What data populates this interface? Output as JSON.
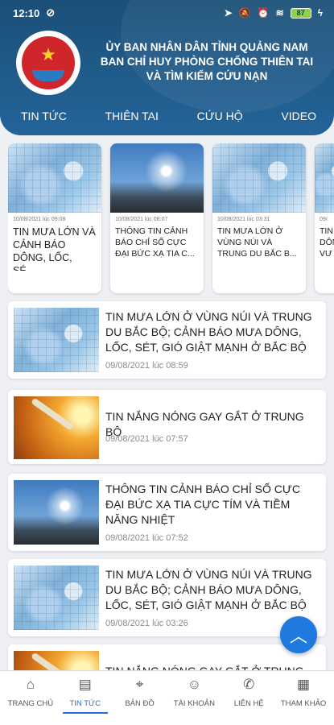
{
  "status": {
    "time": "12:10",
    "battery": "87"
  },
  "org": {
    "line1": "ỦY BAN NHÂN DÂN TỈNH QUẢNG NAM",
    "line2": "BAN CHỈ HUY PHÒNG CHỐNG THIÊN TAI",
    "line3": "VÀ TÌM KIẾM CỨU NẠN"
  },
  "tabs": [
    "TIN TỨC",
    "THIÊN TAI",
    "CỨU HỘ",
    "VIDEO"
  ],
  "carousel": [
    {
      "time": "10/08/2021 lúc 09:08",
      "title": "TIN MƯA LỚN VÀ CẢNH BÁO DÔNG, LỐC, SÉ..."
    },
    {
      "time": "10/08/2021 lúc 08:07",
      "title": "THÔNG TIN CẢNH BÁO CHỈ SỐ CỰC ĐẠI BỨC XẠ TIA C..."
    },
    {
      "time": "10/08/2021 lúc 03:31",
      "title": "TIN MƯA LỚN Ở VÙNG NÚI VÀ TRUNG DU BẮC B..."
    },
    {
      "time": "09/",
      "title": "TIN DÔN VƯ"
    }
  ],
  "news": [
    {
      "title": "TIN MƯA LỚN Ở VÙNG NÚI VÀ TRUNG DU BẮC BỘ; CẢNH BÁO MƯA DÔNG, LỐC, SÉT, GIÓ GIẬT MẠNH Ở BẮC BỘ",
      "time": "09/08/2021 lúc 08:59"
    },
    {
      "title": "TIN NẮNG NÓNG GAY GẮT Ở TRUNG BỘ",
      "time": "09/08/2021 lúc 07:57"
    },
    {
      "title": "THÔNG TIN CẢNH BÁO CHỈ SỐ CỰC ĐẠI BỨC XẠ TIA CỰC TÍM VÀ TIỀM NĂNG NHIỆT",
      "time": "09/08/2021 lúc 07:52"
    },
    {
      "title": "TIN MƯA LỚN Ở VÙNG NÚI VÀ TRUNG DU BẮC BỘ; CẢNH BÁO MƯA DÔNG, LỐC, SÉT, GIÓ GIẬT MẠNH Ở BẮC BỘ",
      "time": "09/08/2021 lúc 03:26"
    },
    {
      "title": "TIN NẮNG NÓNG GAY GẮT Ở TRUNG BỘ",
      "time": ""
    }
  ],
  "bottom_nav": [
    {
      "label": "TRANG CHỦ",
      "icon": "home-icon"
    },
    {
      "label": "TIN TỨC",
      "icon": "news-icon"
    },
    {
      "label": "BẢN ĐỒ",
      "icon": "map-icon"
    },
    {
      "label": "TÀI KHOẢN",
      "icon": "user-icon"
    },
    {
      "label": "LIÊN HỆ",
      "icon": "phone-icon"
    },
    {
      "label": "THAM KHẢO",
      "icon": "grid-icon"
    }
  ],
  "colors": {
    "header": "#1f5b8a",
    "accent": "#1f7ae0"
  }
}
